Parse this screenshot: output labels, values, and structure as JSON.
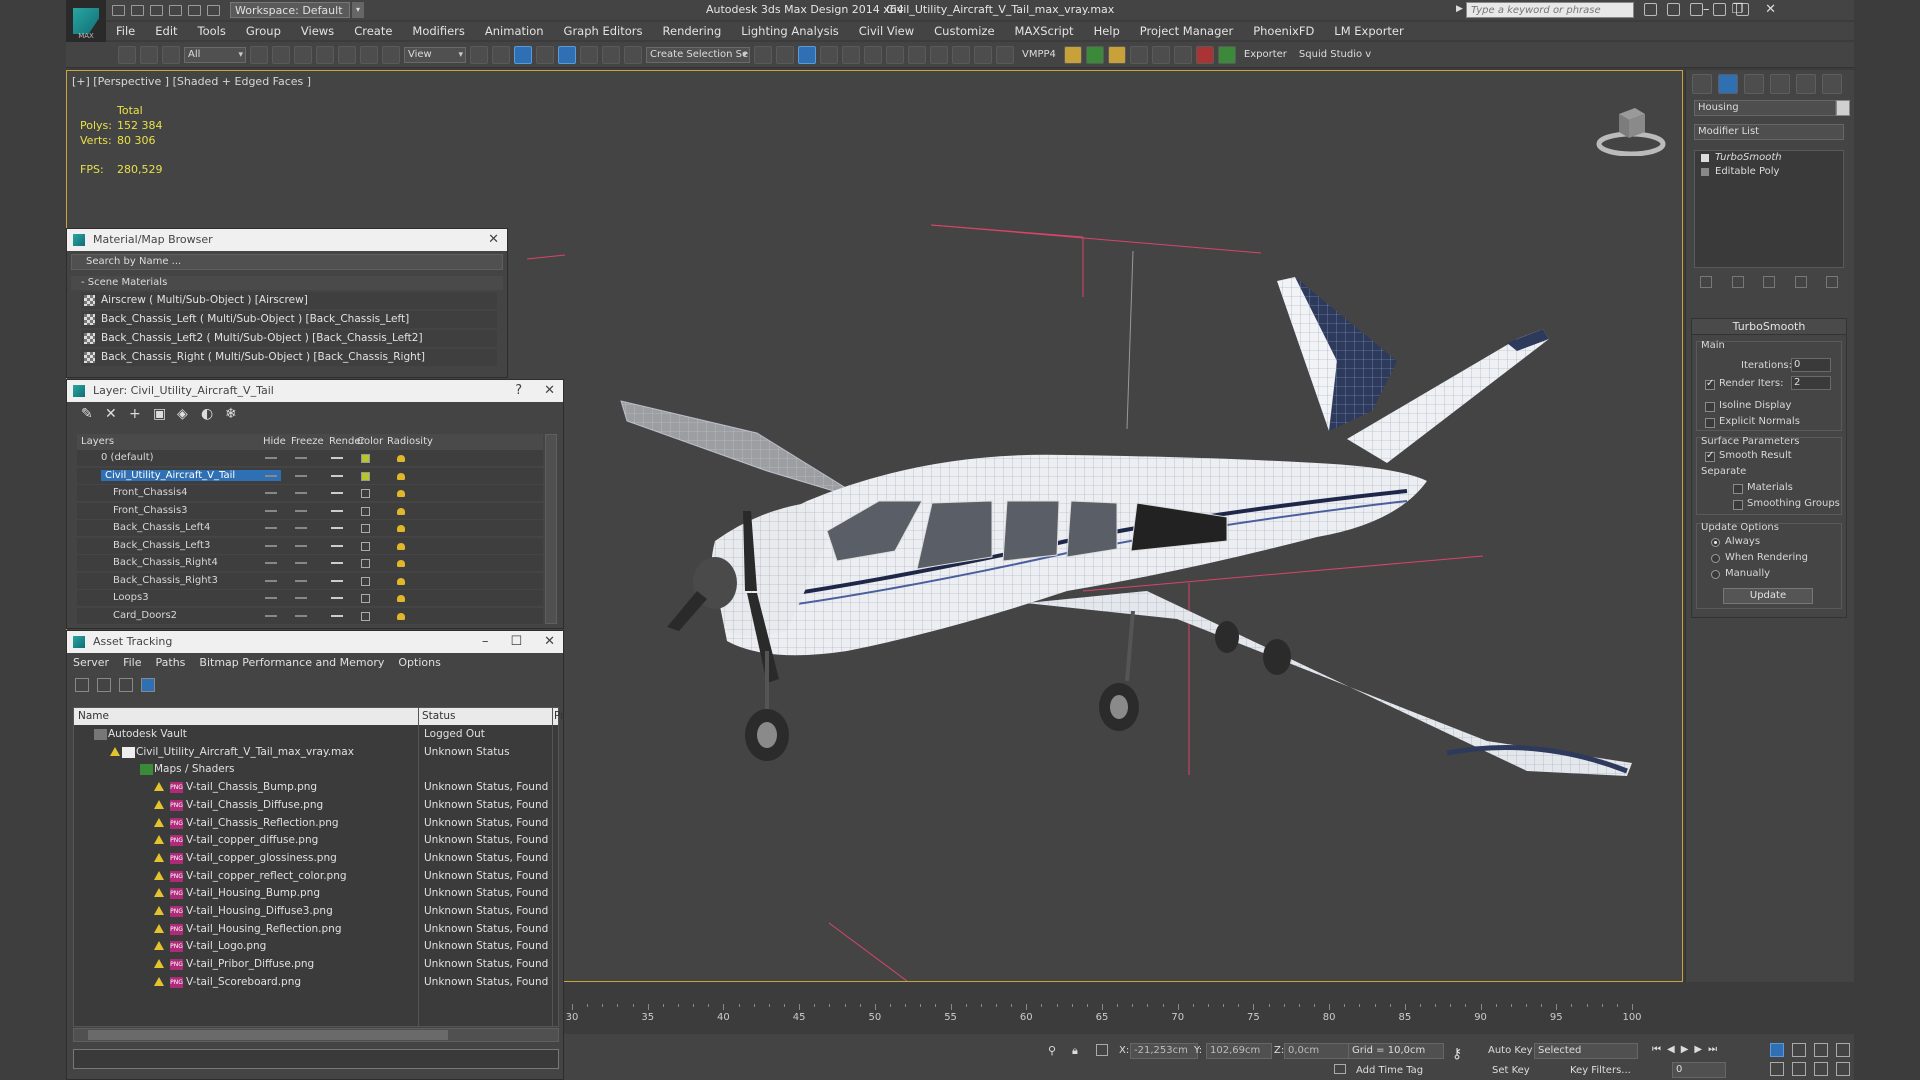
{
  "app": {
    "title": "Autodesk 3ds Max Design 2014 x64",
    "file": "Civil_Utility_Aircraft_V_Tail_max_vray.max",
    "workspace": "Workspace: Default",
    "search_placeholder": "Type a keyword or phrase",
    "logo_text": "MAX"
  },
  "menu": [
    "File",
    "Edit",
    "Tools",
    "Group",
    "Views",
    "Create",
    "Modifiers",
    "Animation",
    "Graph Editors",
    "Rendering",
    "Lighting Analysis",
    "Civil View",
    "Customize",
    "MAXScript",
    "Help",
    "Project Manager",
    "PhoenixFD",
    "LM Exporter"
  ],
  "toolbar": {
    "filter": "All",
    "ref_coord": "View",
    "selection_set": "Create Selection Se",
    "vmpp": "VMPP4",
    "exporter": "Exporter",
    "squid": "Squid Studio v"
  },
  "viewport": {
    "label": "[+] [Perspective ] [Shaded + Edged Faces ]",
    "total_label": "Total",
    "polys_label": "Polys:",
    "polys_value": "152 384",
    "verts_label": "Verts:",
    "verts_value": "80 306",
    "fps_label": "FPS:",
    "fps_value": "280,529"
  },
  "material_browser": {
    "title": "Material/Map Browser",
    "search_placeholder": "Search by Name ...",
    "section": "- Scene Materials",
    "items": [
      "Airscrew  ( Multi/Sub-Object ) [Airscrew]",
      "Back_Chassis_Left  ( Multi/Sub-Object ) [Back_Chassis_Left]",
      "Back_Chassis_Left2  ( Multi/Sub-Object ) [Back_Chassis_Left2]",
      "Back_Chassis_Right  ( Multi/Sub-Object ) [Back_Chassis_Right]"
    ]
  },
  "layer_panel": {
    "title": "Layer: Civil_Utility_Aircraft_V_Tail",
    "help": "?",
    "columns": [
      "Layers",
      "Hide",
      "Freeze",
      "Render",
      "Color",
      "Radiosity"
    ],
    "rows": [
      {
        "name": "0 (default)",
        "color": "#b8c62a"
      },
      {
        "name": "Civil_Utility_Aircraft_V_Tail",
        "color": "#b8c62a"
      },
      {
        "name": "Front_Chassis4",
        "color": ""
      },
      {
        "name": "Front_Chassis3",
        "color": ""
      },
      {
        "name": "Back_Chassis_Left4",
        "color": ""
      },
      {
        "name": "Back_Chassis_Left3",
        "color": ""
      },
      {
        "name": "Back_Chassis_Right4",
        "color": ""
      },
      {
        "name": "Back_Chassis_Right3",
        "color": ""
      },
      {
        "name": "Loops3",
        "color": ""
      },
      {
        "name": "Card_Doors2",
        "color": ""
      }
    ]
  },
  "asset_tracking": {
    "title": "Asset Tracking",
    "menu": [
      "Server",
      "File",
      "Paths",
      "Bitmap Performance and Memory",
      "Options"
    ],
    "columns": [
      "Name",
      "Status",
      "Pr"
    ],
    "rows": [
      {
        "name": "Autodesk Vault",
        "status": "Logged Out"
      },
      {
        "name": "Civil_Utility_Aircraft_V_Tail_max_vray.max",
        "status": "Unknown Status"
      },
      {
        "name": "Maps / Shaders",
        "status": ""
      },
      {
        "name": "V-tail_Chassis_Bump.png",
        "status": "Unknown Status, Found"
      },
      {
        "name": "V-tail_Chassis_Diffuse.png",
        "status": "Unknown Status, Found"
      },
      {
        "name": "V-tail_Chassis_Reflection.png",
        "status": "Unknown Status, Found"
      },
      {
        "name": "V-tail_copper_diffuse.png",
        "status": "Unknown Status, Found"
      },
      {
        "name": "V-tail_copper_glossiness.png",
        "status": "Unknown Status, Found"
      },
      {
        "name": "V-tail_copper_reflect_color.png",
        "status": "Unknown Status, Found"
      },
      {
        "name": "V-tail_Housing_Bump.png",
        "status": "Unknown Status, Found"
      },
      {
        "name": "V-tail_Housing_Diffuse3.png",
        "status": "Unknown Status, Found"
      },
      {
        "name": "V-tail_Housing_Reflection.png",
        "status": "Unknown Status, Found"
      },
      {
        "name": "V-tail_Logo.png",
        "status": "Unknown Status, Found"
      },
      {
        "name": "V-tail_Pribor_Diffuse.png",
        "status": "Unknown Status, Found"
      },
      {
        "name": "V-tail_Scoreboard.png",
        "status": "Unknown Status, Found"
      }
    ]
  },
  "command_panel": {
    "object_name": "Housing",
    "modifier_list": "Modifier List",
    "stack": [
      "TurboSmooth",
      "Editable Poly"
    ],
    "rollout": {
      "title": "TurboSmooth",
      "main": "Main",
      "iterations_label": "Iterations:",
      "iterations_value": "0",
      "render_iters_label": "Render Iters:",
      "render_iters_value": "2",
      "isoline": "Isoline Display",
      "explicit_normals": "Explicit Normals",
      "surface_params": "Surface Parameters",
      "smooth_result": "Smooth Result",
      "separate": "Separate",
      "materials": "Materials",
      "smoothing_groups": "Smoothing Groups",
      "update_options": "Update Options",
      "always": "Always",
      "when_rendering": "When Rendering",
      "manually": "Manually",
      "update_btn": "Update"
    }
  },
  "timeline": {
    "ticks": [
      "30",
      "35",
      "40",
      "45",
      "50",
      "55",
      "60",
      "65",
      "70",
      "75",
      "80",
      "85",
      "90",
      "95",
      "100"
    ]
  },
  "status": {
    "x_label": "X:",
    "x_value": "-21,253cm",
    "y_label": "Y:",
    "y_value": "102,69cm",
    "z_label": "Z:",
    "z_value": "0,0cm",
    "grid": "Grid = 10,0cm",
    "add_time_tag": "Add Time Tag",
    "auto_key": "Auto Key",
    "set_key": "Set Key",
    "selected": "Selected",
    "key_filters": "Key Filters...",
    "frame": "0"
  },
  "colors": {
    "accent_blue": "#2f6fb3",
    "viewport_border": "#c8a53a",
    "stats_yellow": "#e8e04a",
    "wire_pink": "#d8456a"
  }
}
